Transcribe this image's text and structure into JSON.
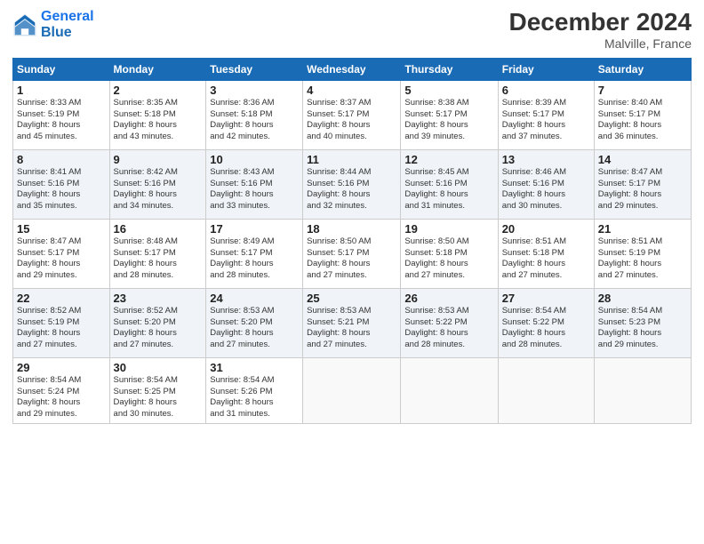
{
  "header": {
    "logo_line1": "General",
    "logo_line2": "Blue",
    "main_title": "December 2024",
    "sub_title": "Malville, France"
  },
  "days_of_week": [
    "Sunday",
    "Monday",
    "Tuesday",
    "Wednesday",
    "Thursday",
    "Friday",
    "Saturday"
  ],
  "weeks": [
    [
      {
        "day": "1",
        "info": "Sunrise: 8:33 AM\nSunset: 5:19 PM\nDaylight: 8 hours\nand 45 minutes."
      },
      {
        "day": "2",
        "info": "Sunrise: 8:35 AM\nSunset: 5:18 PM\nDaylight: 8 hours\nand 43 minutes."
      },
      {
        "day": "3",
        "info": "Sunrise: 8:36 AM\nSunset: 5:18 PM\nDaylight: 8 hours\nand 42 minutes."
      },
      {
        "day": "4",
        "info": "Sunrise: 8:37 AM\nSunset: 5:17 PM\nDaylight: 8 hours\nand 40 minutes."
      },
      {
        "day": "5",
        "info": "Sunrise: 8:38 AM\nSunset: 5:17 PM\nDaylight: 8 hours\nand 39 minutes."
      },
      {
        "day": "6",
        "info": "Sunrise: 8:39 AM\nSunset: 5:17 PM\nDaylight: 8 hours\nand 37 minutes."
      },
      {
        "day": "7",
        "info": "Sunrise: 8:40 AM\nSunset: 5:17 PM\nDaylight: 8 hours\nand 36 minutes."
      }
    ],
    [
      {
        "day": "8",
        "info": "Sunrise: 8:41 AM\nSunset: 5:16 PM\nDaylight: 8 hours\nand 35 minutes."
      },
      {
        "day": "9",
        "info": "Sunrise: 8:42 AM\nSunset: 5:16 PM\nDaylight: 8 hours\nand 34 minutes."
      },
      {
        "day": "10",
        "info": "Sunrise: 8:43 AM\nSunset: 5:16 PM\nDaylight: 8 hours\nand 33 minutes."
      },
      {
        "day": "11",
        "info": "Sunrise: 8:44 AM\nSunset: 5:16 PM\nDaylight: 8 hours\nand 32 minutes."
      },
      {
        "day": "12",
        "info": "Sunrise: 8:45 AM\nSunset: 5:16 PM\nDaylight: 8 hours\nand 31 minutes."
      },
      {
        "day": "13",
        "info": "Sunrise: 8:46 AM\nSunset: 5:16 PM\nDaylight: 8 hours\nand 30 minutes."
      },
      {
        "day": "14",
        "info": "Sunrise: 8:47 AM\nSunset: 5:17 PM\nDaylight: 8 hours\nand 29 minutes."
      }
    ],
    [
      {
        "day": "15",
        "info": "Sunrise: 8:47 AM\nSunset: 5:17 PM\nDaylight: 8 hours\nand 29 minutes."
      },
      {
        "day": "16",
        "info": "Sunrise: 8:48 AM\nSunset: 5:17 PM\nDaylight: 8 hours\nand 28 minutes."
      },
      {
        "day": "17",
        "info": "Sunrise: 8:49 AM\nSunset: 5:17 PM\nDaylight: 8 hours\nand 28 minutes."
      },
      {
        "day": "18",
        "info": "Sunrise: 8:50 AM\nSunset: 5:17 PM\nDaylight: 8 hours\nand 27 minutes."
      },
      {
        "day": "19",
        "info": "Sunrise: 8:50 AM\nSunset: 5:18 PM\nDaylight: 8 hours\nand 27 minutes."
      },
      {
        "day": "20",
        "info": "Sunrise: 8:51 AM\nSunset: 5:18 PM\nDaylight: 8 hours\nand 27 minutes."
      },
      {
        "day": "21",
        "info": "Sunrise: 8:51 AM\nSunset: 5:19 PM\nDaylight: 8 hours\nand 27 minutes."
      }
    ],
    [
      {
        "day": "22",
        "info": "Sunrise: 8:52 AM\nSunset: 5:19 PM\nDaylight: 8 hours\nand 27 minutes."
      },
      {
        "day": "23",
        "info": "Sunrise: 8:52 AM\nSunset: 5:20 PM\nDaylight: 8 hours\nand 27 minutes."
      },
      {
        "day": "24",
        "info": "Sunrise: 8:53 AM\nSunset: 5:20 PM\nDaylight: 8 hours\nand 27 minutes."
      },
      {
        "day": "25",
        "info": "Sunrise: 8:53 AM\nSunset: 5:21 PM\nDaylight: 8 hours\nand 27 minutes."
      },
      {
        "day": "26",
        "info": "Sunrise: 8:53 AM\nSunset: 5:22 PM\nDaylight: 8 hours\nand 28 minutes."
      },
      {
        "day": "27",
        "info": "Sunrise: 8:54 AM\nSunset: 5:22 PM\nDaylight: 8 hours\nand 28 minutes."
      },
      {
        "day": "28",
        "info": "Sunrise: 8:54 AM\nSunset: 5:23 PM\nDaylight: 8 hours\nand 29 minutes."
      }
    ],
    [
      {
        "day": "29",
        "info": "Sunrise: 8:54 AM\nSunset: 5:24 PM\nDaylight: 8 hours\nand 29 minutes."
      },
      {
        "day": "30",
        "info": "Sunrise: 8:54 AM\nSunset: 5:25 PM\nDaylight: 8 hours\nand 30 minutes."
      },
      {
        "day": "31",
        "info": "Sunrise: 8:54 AM\nSunset: 5:26 PM\nDaylight: 8 hours\nand 31 minutes."
      },
      null,
      null,
      null,
      null
    ]
  ]
}
